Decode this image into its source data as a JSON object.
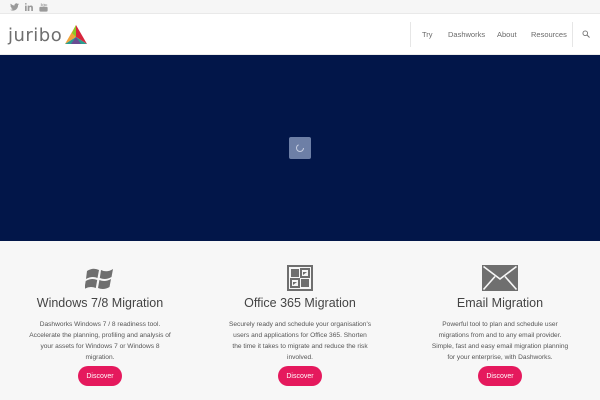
{
  "topbar": {
    "social": [
      {
        "icon": "twitter-icon"
      },
      {
        "icon": "linkedin-icon"
      },
      {
        "icon": "youtube-icon"
      }
    ]
  },
  "header": {
    "logo_text": "juribo",
    "nav": [
      {
        "label": "Try"
      },
      {
        "label": "Dashworks"
      },
      {
        "label": "About"
      },
      {
        "label": "Resources"
      }
    ],
    "search_icon": "search-icon"
  },
  "hero": {
    "background": "#021649",
    "loader_icon": "spinner-icon"
  },
  "colors": {
    "accent": "#e5195d",
    "hero_bg": "#021649",
    "features_bg": "#f7f7f7"
  },
  "features": [
    {
      "icon": "windows-icon",
      "title": "Windows 7/8 Migration",
      "description": "Dashworks Windows 7 / 8 readiness tool. Accelerate the planning, profiling and analysis of your assets for Windows 7 or Windows 8 migration.",
      "button_label": "Discover"
    },
    {
      "icon": "office-icon",
      "title": "Office 365 Migration",
      "description": "Securely ready and schedule your organisation's users and applications for Office 365. Shorten the time it takes to migrate and reduce the risk involved.",
      "button_label": "Discover"
    },
    {
      "icon": "envelope-icon",
      "title": "Email Migration",
      "description": "Powerful tool to plan and schedule user migrations from and to any email provider. Simple, fast and easy email migration planning for your enterprise, with Dashworks.",
      "button_label": "Discover"
    }
  ]
}
